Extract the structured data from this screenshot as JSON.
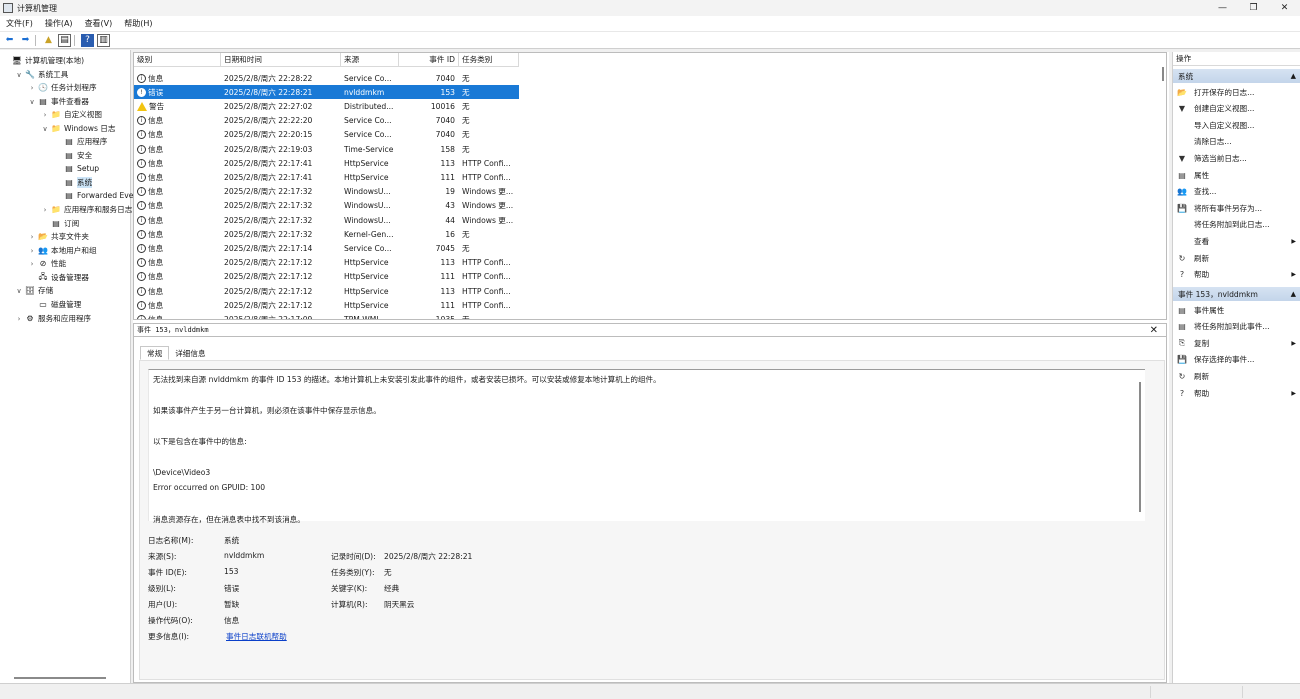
{
  "window": {
    "title": "计算机管理",
    "minimize": "—",
    "maximize": "❐",
    "close": "✕"
  },
  "menu": [
    "文件(F)",
    "操作(A)",
    "查看(V)",
    "帮助(H)"
  ],
  "tree": [
    {
      "label": "计算机管理(本地)",
      "exp": "",
      "icon": "computer-management-icon",
      "glyph": "🖥",
      "indent": 0
    },
    {
      "label": "系统工具",
      "exp": "∨",
      "icon": "tools-icon",
      "glyph": "🔧",
      "indent": 1
    },
    {
      "label": "任务计划程序",
      "exp": "›",
      "icon": "clock-icon",
      "glyph": "🕓",
      "indent": 2
    },
    {
      "label": "事件查看器",
      "exp": "∨",
      "icon": "event-viewer-icon",
      "glyph": "▤",
      "indent": 2
    },
    {
      "label": "自定义视图",
      "exp": "›",
      "icon": "folder-icon",
      "glyph": "📁",
      "indent": 3
    },
    {
      "label": "Windows 日志",
      "exp": "∨",
      "icon": "folder-icon",
      "glyph": "📁",
      "indent": 3
    },
    {
      "label": "应用程序",
      "exp": "",
      "icon": "log-icon",
      "glyph": "▤",
      "indent": 4
    },
    {
      "label": "安全",
      "exp": "",
      "icon": "log-icon",
      "glyph": "▤",
      "indent": 4
    },
    {
      "label": "Setup",
      "exp": "",
      "icon": "log-icon",
      "glyph": "▤",
      "indent": 4
    },
    {
      "label": "系统",
      "exp": "",
      "icon": "log-icon",
      "glyph": "▤",
      "indent": 4,
      "selected": true
    },
    {
      "label": "Forwarded Eve",
      "exp": "",
      "icon": "log-icon",
      "glyph": "▤",
      "indent": 4
    },
    {
      "label": "应用程序和服务日志",
      "exp": "›",
      "icon": "folder-icon",
      "glyph": "📁",
      "indent": 3
    },
    {
      "label": "订阅",
      "exp": "",
      "icon": "subscription-icon",
      "glyph": "▤",
      "indent": 3
    },
    {
      "label": "共享文件夹",
      "exp": "›",
      "icon": "shared-folder-icon",
      "glyph": "📂",
      "indent": 2
    },
    {
      "label": "本地用户和组",
      "exp": "›",
      "icon": "users-icon",
      "glyph": "👥",
      "indent": 2
    },
    {
      "label": "性能",
      "exp": "›",
      "icon": "performance-icon",
      "glyph": "⊘",
      "indent": 2
    },
    {
      "label": "设备管理器",
      "exp": "",
      "icon": "device-manager-icon",
      "glyph": "🖧",
      "indent": 2
    },
    {
      "label": "存储",
      "exp": "∨",
      "icon": "storage-icon",
      "glyph": "🗄",
      "indent": 1
    },
    {
      "label": "磁盘管理",
      "exp": "",
      "icon": "disk-icon",
      "glyph": "▭",
      "indent": 2
    },
    {
      "label": "服务和应用程序",
      "exp": "›",
      "icon": "services-icon",
      "glyph": "⚙",
      "indent": 1
    }
  ],
  "events": {
    "headers": [
      "级别",
      "日期和时间",
      "来源",
      "事件 ID",
      "任务类别"
    ],
    "rows": [
      {
        "level": "信息",
        "type": "info",
        "datetime": "2025/2/8/周六 22:28:22",
        "source": "Service Co...",
        "id": "7040",
        "category": "无"
      },
      {
        "level": "错误",
        "type": "error",
        "datetime": "2025/2/8/周六 22:28:21",
        "source": "nvlddmkm",
        "id": "153",
        "category": "无",
        "selected": true
      },
      {
        "level": "警告",
        "type": "warn",
        "datetime": "2025/2/8/周六 22:27:02",
        "source": "Distributed...",
        "id": "10016",
        "category": "无"
      },
      {
        "level": "信息",
        "type": "info",
        "datetime": "2025/2/8/周六 22:22:20",
        "source": "Service Co...",
        "id": "7040",
        "category": "无"
      },
      {
        "level": "信息",
        "type": "info",
        "datetime": "2025/2/8/周六 22:20:15",
        "source": "Service Co...",
        "id": "7040",
        "category": "无"
      },
      {
        "level": "信息",
        "type": "info",
        "datetime": "2025/2/8/周六 22:19:03",
        "source": "Time-Service",
        "id": "158",
        "category": "无"
      },
      {
        "level": "信息",
        "type": "info",
        "datetime": "2025/2/8/周六 22:17:41",
        "source": "HttpService",
        "id": "113",
        "category": "HTTP Confi..."
      },
      {
        "level": "信息",
        "type": "info",
        "datetime": "2025/2/8/周六 22:17:41",
        "source": "HttpService",
        "id": "111",
        "category": "HTTP Confi..."
      },
      {
        "level": "信息",
        "type": "info",
        "datetime": "2025/2/8/周六 22:17:32",
        "source": "WindowsU...",
        "id": "19",
        "category": "Windows 更..."
      },
      {
        "level": "信息",
        "type": "info",
        "datetime": "2025/2/8/周六 22:17:32",
        "source": "WindowsU...",
        "id": "43",
        "category": "Windows 更..."
      },
      {
        "level": "信息",
        "type": "info",
        "datetime": "2025/2/8/周六 22:17:32",
        "source": "WindowsU...",
        "id": "44",
        "category": "Windows 更..."
      },
      {
        "level": "信息",
        "type": "info",
        "datetime": "2025/2/8/周六 22:17:32",
        "source": "Kernel-Gen...",
        "id": "16",
        "category": "无"
      },
      {
        "level": "信息",
        "type": "info",
        "datetime": "2025/2/8/周六 22:17:14",
        "source": "Service Co...",
        "id": "7045",
        "category": "无"
      },
      {
        "level": "信息",
        "type": "info",
        "datetime": "2025/2/8/周六 22:17:12",
        "source": "HttpService",
        "id": "113",
        "category": "HTTP Confi..."
      },
      {
        "level": "信息",
        "type": "info",
        "datetime": "2025/2/8/周六 22:17:12",
        "source": "HttpService",
        "id": "111",
        "category": "HTTP Confi..."
      },
      {
        "level": "信息",
        "type": "info",
        "datetime": "2025/2/8/周六 22:17:12",
        "source": "HttpService",
        "id": "113",
        "category": "HTTP Confi..."
      },
      {
        "level": "信息",
        "type": "info",
        "datetime": "2025/2/8/周六 22:17:12",
        "source": "HttpService",
        "id": "111",
        "category": "HTTP Confi..."
      },
      {
        "level": "信息",
        "type": "info",
        "datetime": "2025/2/8/周六 22:17:09",
        "source": "TPM-WMI",
        "id": "1035",
        "category": "无"
      }
    ]
  },
  "detail": {
    "title": "事件 153，nvlddmkm",
    "tabs": [
      "常规",
      "详细信息"
    ],
    "description": [
      "无法找到来自源 nvlddmkm 的事件 ID 153 的描述。本地计算机上未安装引发此事件的组件，或者安装已损坏。可以安装或修复本地计算机上的组件。",
      "如果该事件产生于另一台计算机，则必须在该事件中保存显示信息。",
      "以下是包含在事件中的信息:",
      "\\Device\\Video3",
      "Error occurred on GPUID: 100",
      "消息资源存在，但在消息表中找不到该消息。"
    ],
    "props": {
      "log_name_label": "日志名称(M):",
      "log_name": "系统",
      "source_label": "来源(S):",
      "source": "nvlddmkm",
      "logged_label": "记录时间(D):",
      "logged": "2025/2/8/周六 22:28:21",
      "event_id_label": "事件 ID(E):",
      "event_id": "153",
      "task_label": "任务类别(Y):",
      "task": "无",
      "level_label": "级别(L):",
      "level": "错误",
      "keywords_label": "关键字(K):",
      "keywords": "经典",
      "user_label": "用户(U):",
      "user": "暂缺",
      "computer_label": "计算机(R):",
      "computer": "阴天黑云",
      "opcode_label": "操作代码(O):",
      "opcode": "信息",
      "more_label": "更多信息(I):",
      "more_link": "事件日志联机帮助"
    }
  },
  "actions": {
    "title": "操作",
    "section1": "系统",
    "items1": [
      {
        "label": "打开保存的日志...",
        "icon": "open-log-icon",
        "glyph": "📂"
      },
      {
        "label": "创建自定义视图...",
        "icon": "filter-icon",
        "glyph": "▼"
      },
      {
        "label": "导入自定义视图...",
        "icon": "",
        "glyph": ""
      },
      {
        "label": "清除日志...",
        "icon": "",
        "glyph": ""
      },
      {
        "label": "筛选当前日志...",
        "icon": "filter-icon",
        "glyph": "▼"
      },
      {
        "label": "属性",
        "icon": "properties-icon",
        "glyph": "▤"
      },
      {
        "label": "查找...",
        "icon": "find-icon",
        "glyph": "👥"
      },
      {
        "label": "将所有事件另存为...",
        "icon": "save-icon",
        "glyph": "💾"
      },
      {
        "label": "将任务附加到此日志...",
        "icon": "",
        "glyph": ""
      },
      {
        "label": "查看",
        "icon": "",
        "glyph": "",
        "sub": true
      },
      {
        "label": "刷新",
        "icon": "refresh-icon",
        "glyph": "↻"
      },
      {
        "label": "帮助",
        "icon": "help-icon",
        "glyph": "?",
        "sub": true
      }
    ],
    "section2": "事件 153，nvlddmkm",
    "items2": [
      {
        "label": "事件属性",
        "icon": "event-properties-icon",
        "glyph": "▤"
      },
      {
        "label": "将任务附加到此事件...",
        "icon": "attach-task-icon",
        "glyph": "▤"
      },
      {
        "label": "复制",
        "icon": "copy-icon",
        "glyph": "⎘",
        "sub": true
      },
      {
        "label": "保存选择的事件...",
        "icon": "save-icon",
        "glyph": "💾"
      },
      {
        "label": "刷新",
        "icon": "refresh-icon",
        "glyph": "↻"
      },
      {
        "label": "帮助",
        "icon": "help-icon",
        "glyph": "?",
        "sub": true
      }
    ]
  }
}
